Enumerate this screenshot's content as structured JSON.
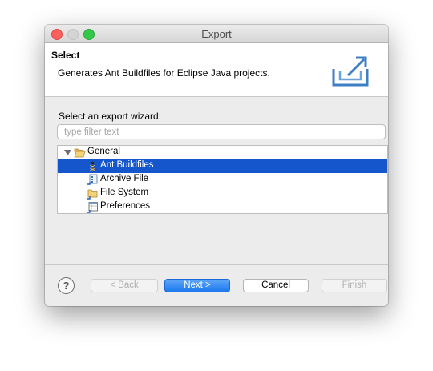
{
  "window": {
    "title": "Export"
  },
  "header": {
    "title": "Select",
    "description": "Generates Ant Buildfiles for Eclipse Java projects.",
    "icon": "export-icon"
  },
  "wizard": {
    "label": "Select an export wizard:",
    "filter_placeholder": "type filter text",
    "filter_value": ""
  },
  "tree": {
    "items": [
      {
        "label": "General",
        "icon": "folder-open-icon",
        "expanded": true,
        "selected": false
      },
      {
        "label": "Ant Buildfiles",
        "icon": "ant-icon",
        "selected": true
      },
      {
        "label": "Archive File",
        "icon": "archive-icon",
        "selected": false
      },
      {
        "label": "File System",
        "icon": "folder-icon",
        "selected": false
      },
      {
        "label": "Preferences",
        "icon": "preferences-icon",
        "selected": false
      }
    ]
  },
  "buttons": {
    "back": "< Back",
    "next": "Next >",
    "cancel": "Cancel",
    "finish": "Finish"
  },
  "colors": {
    "selection": "#1556cc",
    "default_button": "#1c78f0"
  }
}
